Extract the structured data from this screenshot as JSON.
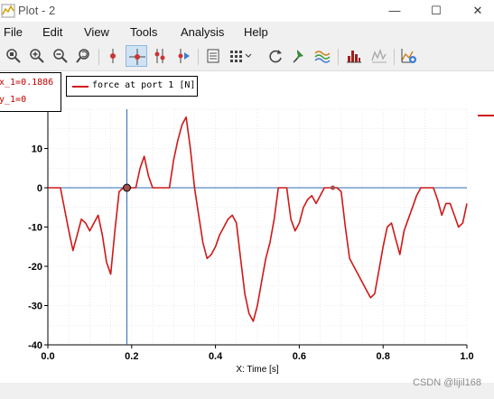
{
  "window": {
    "title": "Plot - 2",
    "controls": {
      "minimize": "—",
      "maximize": "☐",
      "close": "✕"
    }
  },
  "menu": [
    "File",
    "Edit",
    "View",
    "Tools",
    "Analysis",
    "Help"
  ],
  "toolbar": {
    "icons": [
      "home-zoom-icon",
      "zoom-in-icon",
      "zoom-out-icon",
      "zoom-reset-icon",
      "single-cursor-icon",
      "crosshair-cursor-icon",
      "dual-cursor-icon",
      "trace-cursor-icon",
      "data-table-icon",
      "grid-layout-icon",
      "refresh-icon",
      "pin-tool-icon",
      "waves-icon",
      "histogram-icon",
      "spectrum-icon",
      "add-plot-icon"
    ],
    "active": "crosshair-cursor-icon"
  },
  "cursor_readout": {
    "x_text": "x_1=0.1886",
    "y_text": "y_1=0"
  },
  "legend": {
    "label": "force at port 1 [N]",
    "color": "#d01818"
  },
  "watermark": "CSDN @lijil168",
  "chart_data": {
    "type": "line",
    "xlabel": "X: Time [s]",
    "ylabel": "",
    "xlim": [
      0,
      1
    ],
    "ylim": [
      -40,
      20
    ],
    "xticks": [
      0,
      0.2,
      0.4,
      0.6,
      0.8,
      1
    ],
    "xtick_labels": [
      "0.0",
      "0.2",
      "0.4",
      "0.6",
      "0.8",
      "1.0"
    ],
    "yticks": [
      10,
      0,
      -10,
      -20,
      -30,
      -40
    ],
    "ytick_labels": [
      "10",
      "0",
      "-10",
      "-20",
      "-30",
      "-40"
    ],
    "grid": true,
    "cursor": {
      "x": 0.1886,
      "y": 0
    },
    "reference_line_y": 0,
    "series": [
      {
        "name": "force at port 1 [N]",
        "color": "#d01818",
        "x": [
          0.0,
          0.03,
          0.05,
          0.06,
          0.07,
          0.08,
          0.09,
          0.1,
          0.11,
          0.12,
          0.13,
          0.14,
          0.15,
          0.16,
          0.17,
          0.18,
          0.19,
          0.2,
          0.21,
          0.22,
          0.23,
          0.24,
          0.25,
          0.26,
          0.27,
          0.28,
          0.29,
          0.3,
          0.31,
          0.32,
          0.33,
          0.34,
          0.35,
          0.36,
          0.37,
          0.38,
          0.39,
          0.4,
          0.41,
          0.42,
          0.43,
          0.44,
          0.45,
          0.46,
          0.47,
          0.48,
          0.49,
          0.5,
          0.51,
          0.52,
          0.53,
          0.54,
          0.55,
          0.56,
          0.57,
          0.58,
          0.59,
          0.6,
          0.61,
          0.62,
          0.63,
          0.64,
          0.65,
          0.66,
          0.67,
          0.68,
          0.69,
          0.7,
          0.71,
          0.72,
          0.73,
          0.74,
          0.75,
          0.76,
          0.77,
          0.78,
          0.79,
          0.8,
          0.81,
          0.82,
          0.83,
          0.84,
          0.85,
          0.86,
          0.87,
          0.88,
          0.89,
          0.9,
          0.91,
          0.92,
          0.93,
          0.94,
          0.95,
          0.96,
          0.97,
          0.98,
          0.99,
          1.0
        ],
        "y": [
          0,
          0,
          -11,
          -16,
          -12,
          -8,
          -9,
          -11,
          -9,
          -7,
          -12,
          -19,
          -22,
          -11,
          -1,
          0,
          0,
          0,
          0,
          5,
          8,
          3,
          0,
          0,
          0,
          0,
          0,
          7,
          12,
          16,
          18,
          10,
          0,
          -7,
          -14,
          -18,
          -17,
          -15,
          -12,
          -10,
          -8,
          -7,
          -9,
          -18,
          -27,
          -32,
          -34,
          -30,
          -24,
          -18,
          -14,
          -8,
          0,
          0,
          0,
          -8,
          -11,
          -9,
          -5,
          -3,
          -2,
          -4,
          -2,
          0,
          0,
          0,
          0,
          -1,
          -10,
          -18,
          -20,
          -22,
          -24,
          -26,
          -28,
          -27,
          -21,
          -15,
          -10,
          -9,
          -13,
          -17,
          -11,
          -8,
          -5,
          -2,
          0,
          0,
          0,
          0,
          -3,
          -7,
          -4,
          -4,
          -7,
          -10,
          -9,
          -4
        ]
      }
    ]
  }
}
